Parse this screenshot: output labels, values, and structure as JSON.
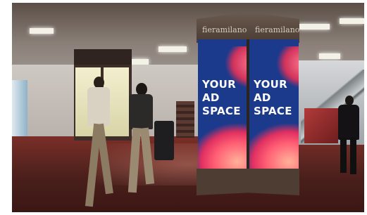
{
  "scene": {
    "kiosk_brand_left": "fieramilano",
    "kiosk_brand_right": "fieramilano",
    "ad_left": "YOUR AD SPACE",
    "ad_right": "YOUR AD SPACE",
    "colors": {
      "screen_bg": "#1c3a8c",
      "swirl": "#ff5e73",
      "floor": "#7a2f28"
    }
  }
}
